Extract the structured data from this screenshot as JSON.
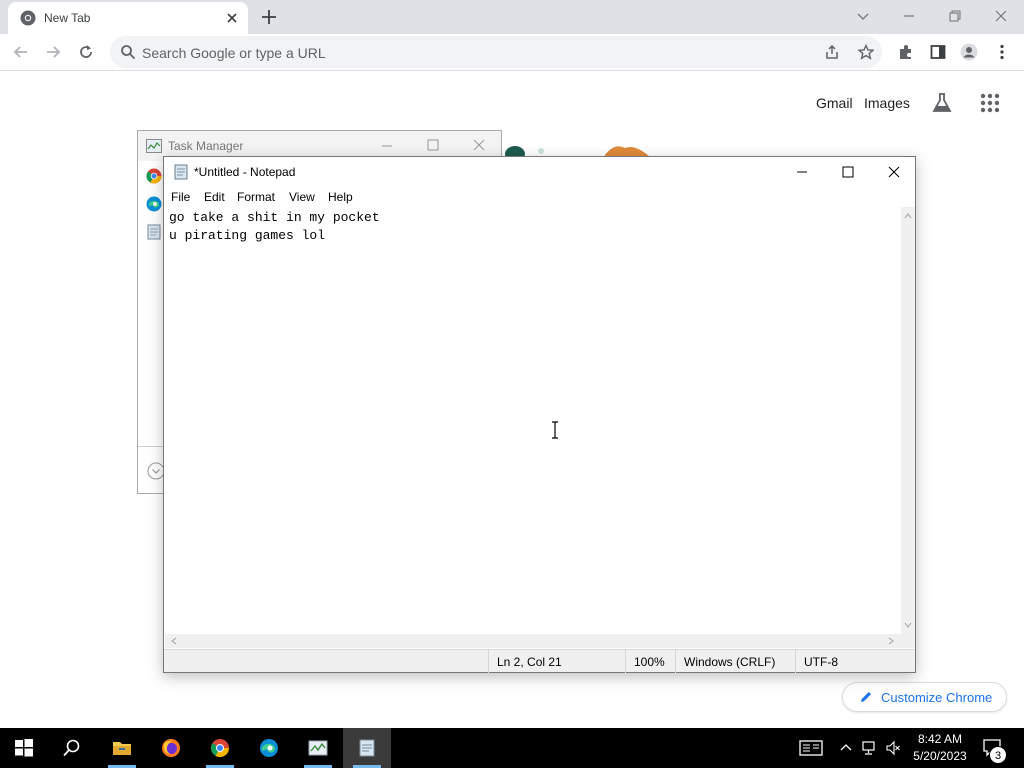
{
  "browser": {
    "tab": {
      "title": "New Tab",
      "favicon": "chrome-icon",
      "close_icon": "close-icon"
    },
    "new_tab_icon": "plus-icon",
    "window_controls": [
      "chevron-down-icon",
      "minimize-icon",
      "restore-icon",
      "close-icon"
    ],
    "toolbar": {
      "back_icon": "back-arrow-icon",
      "forward_icon": "forward-arrow-icon",
      "reload_icon": "reload-icon",
      "omnibox_placeholder": "Search Google or type a URL",
      "share_icon": "share-icon",
      "bookmark_icon": "star-icon",
      "extensions_icon": "puzzle-icon",
      "side_panel_icon": "side-panel-icon",
      "profile_icon": "profile-icon",
      "menu_icon": "kebab-menu-icon"
    }
  },
  "ntp": {
    "links": {
      "gmail": "Gmail",
      "images": "Images"
    },
    "labs_icon": "flask-icon",
    "apps_icon": "apps-grid-icon",
    "customize_label": "Customize Chrome",
    "customize_icon": "pencil-icon"
  },
  "task_manager": {
    "title": "Task Manager",
    "apps": [
      "chrome-icon",
      "edge-icon",
      "notepad-icon"
    ],
    "fewer_details_icon": "chevron-circle-icon"
  },
  "notepad": {
    "title": "*Untitled - Notepad",
    "menu": [
      "File",
      "Edit",
      "Format",
      "View",
      "Help"
    ],
    "lines": [
      "go take a shit in my pocket",
      "u pirating games lol"
    ],
    "status": {
      "position": "Ln 2, Col 21",
      "zoom": "100%",
      "line_endings": "Windows (CRLF)",
      "encoding": "UTF-8"
    }
  },
  "taskbar": {
    "apps": [
      "windows-start-icon",
      "search-icon",
      "file-explorer-icon",
      "firefox-icon",
      "chrome-icon",
      "edge-icon",
      "task-manager-icon",
      "notepad-icon"
    ],
    "clock": {
      "time": "8:42 AM",
      "date": "5/20/2023"
    },
    "notification_count": "3"
  }
}
